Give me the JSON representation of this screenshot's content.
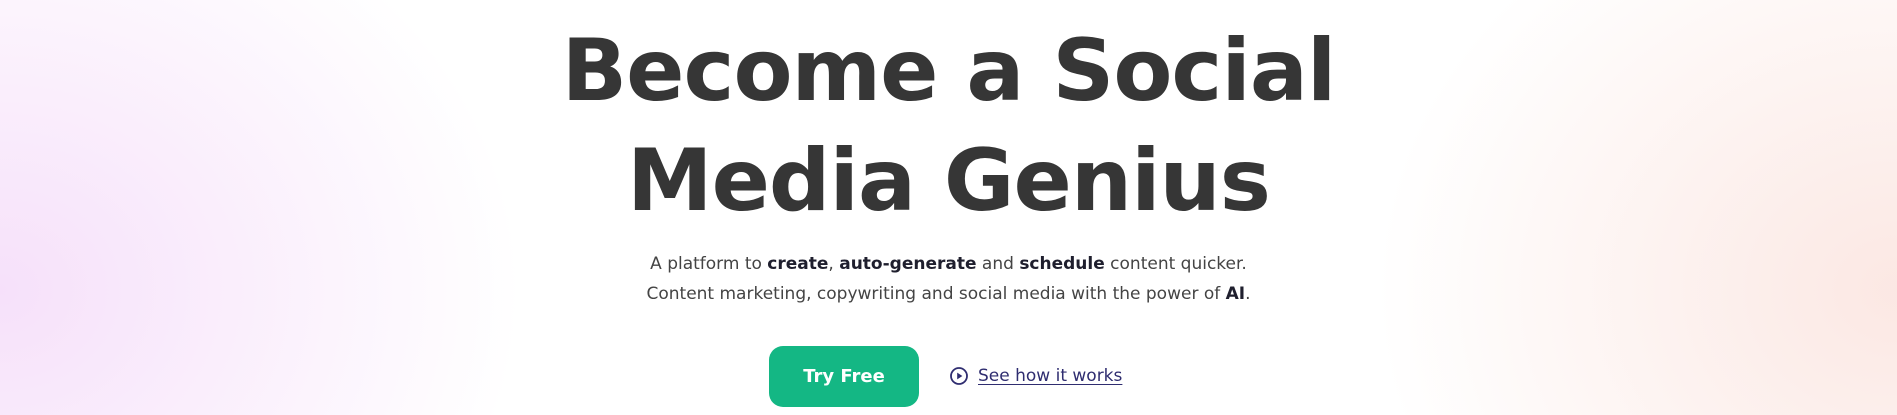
{
  "hero": {
    "headline_line1": "Become a Social",
    "headline_line2": "Media Genius",
    "subtitle_line1": {
      "prefix": "A platform to ",
      "create": "create",
      "sep1": ", ",
      "auto_generate": "auto-generate",
      "sep2": " and ",
      "schedule": "schedule",
      "suffix": " content quicker."
    },
    "subtitle_line2": {
      "prefix": "Content marketing, copywriting and social media with the power of ",
      "ai": "AI",
      "suffix": "."
    },
    "cta_primary_label": "Try Free",
    "cta_secondary_label": "See how it works",
    "cta_secondary_icon": "play-circle-icon"
  },
  "colors": {
    "headline": "#363636",
    "primary_button": "#14b784",
    "link": "#2f2d70",
    "background_left_glow": "#f3d6f8",
    "background_right_glow": "#fae0da"
  }
}
